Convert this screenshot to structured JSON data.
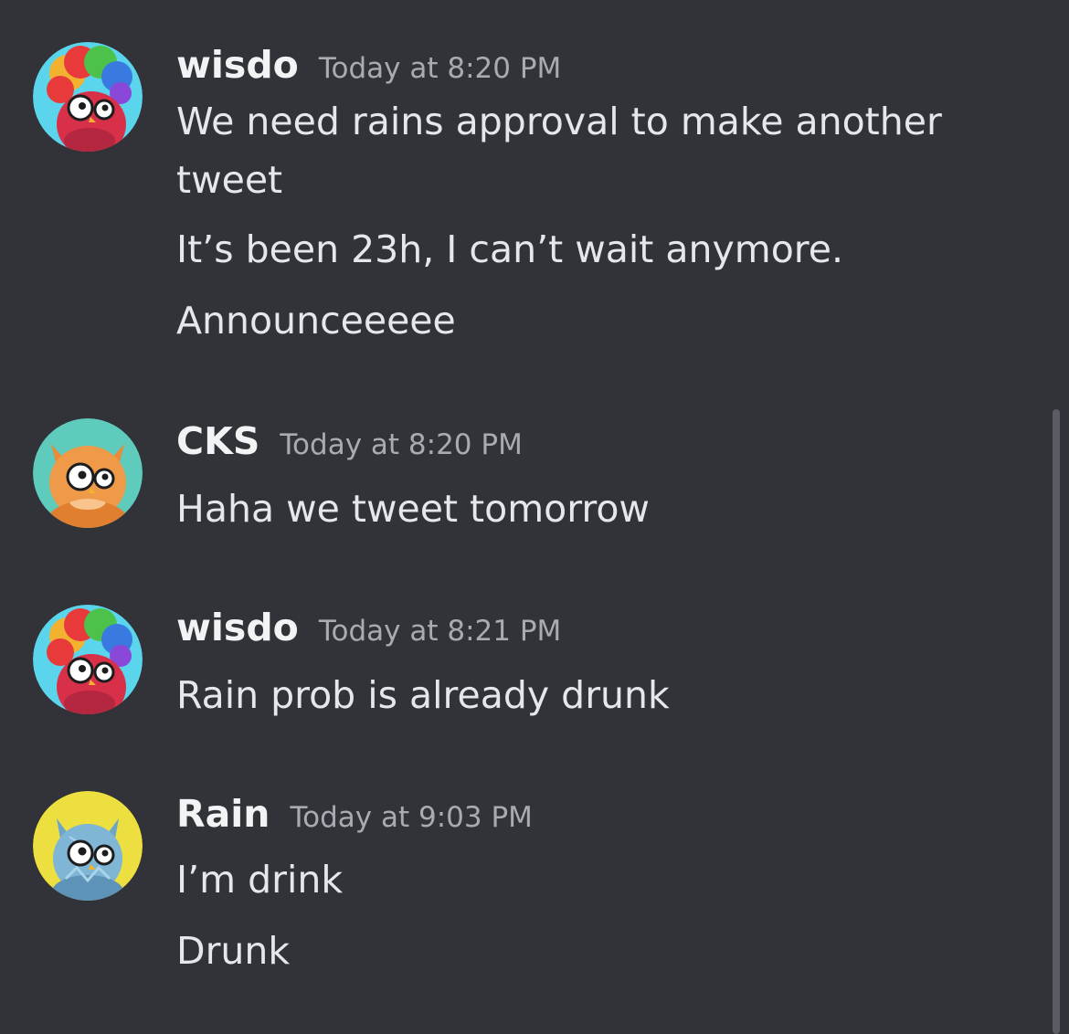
{
  "messages": [
    {
      "username": "wisdo",
      "timestamp": "Today at 8:20 PM",
      "avatar_icon": "rainbow-afro-red-owl-avatar",
      "avatar_bg": "#5ad5ec",
      "lines": [
        "We need rains approval to make another",
        "tweet",
        "It’s been 23h, I can’t wait anymore.",
        "Announceeeee"
      ]
    },
    {
      "username": "CKS",
      "timestamp": "Today at 8:20 PM",
      "avatar_icon": "orange-owl-avatar",
      "avatar_bg": "#5fcbbd",
      "lines": [
        "Haha we tweet tomorrow"
      ]
    },
    {
      "username": "wisdo",
      "timestamp": "Today at 8:21 PM",
      "avatar_icon": "rainbow-afro-red-owl-avatar",
      "avatar_bg": "#5ad5ec",
      "lines": [
        "Rain prob is already drunk"
      ]
    },
    {
      "username": "Rain",
      "timestamp": "Today at 9:03 PM",
      "avatar_icon": "blue-crystal-owl-avatar",
      "avatar_bg": "#ecdf3f",
      "lines": [
        "I’m drink",
        "Drunk"
      ]
    }
  ],
  "colors": {
    "background": "#313338",
    "username": "#f2f3f5",
    "timestamp": "#a9abb2",
    "message_text": "#e6e7ea",
    "scrollbar": "#5a5c63"
  }
}
